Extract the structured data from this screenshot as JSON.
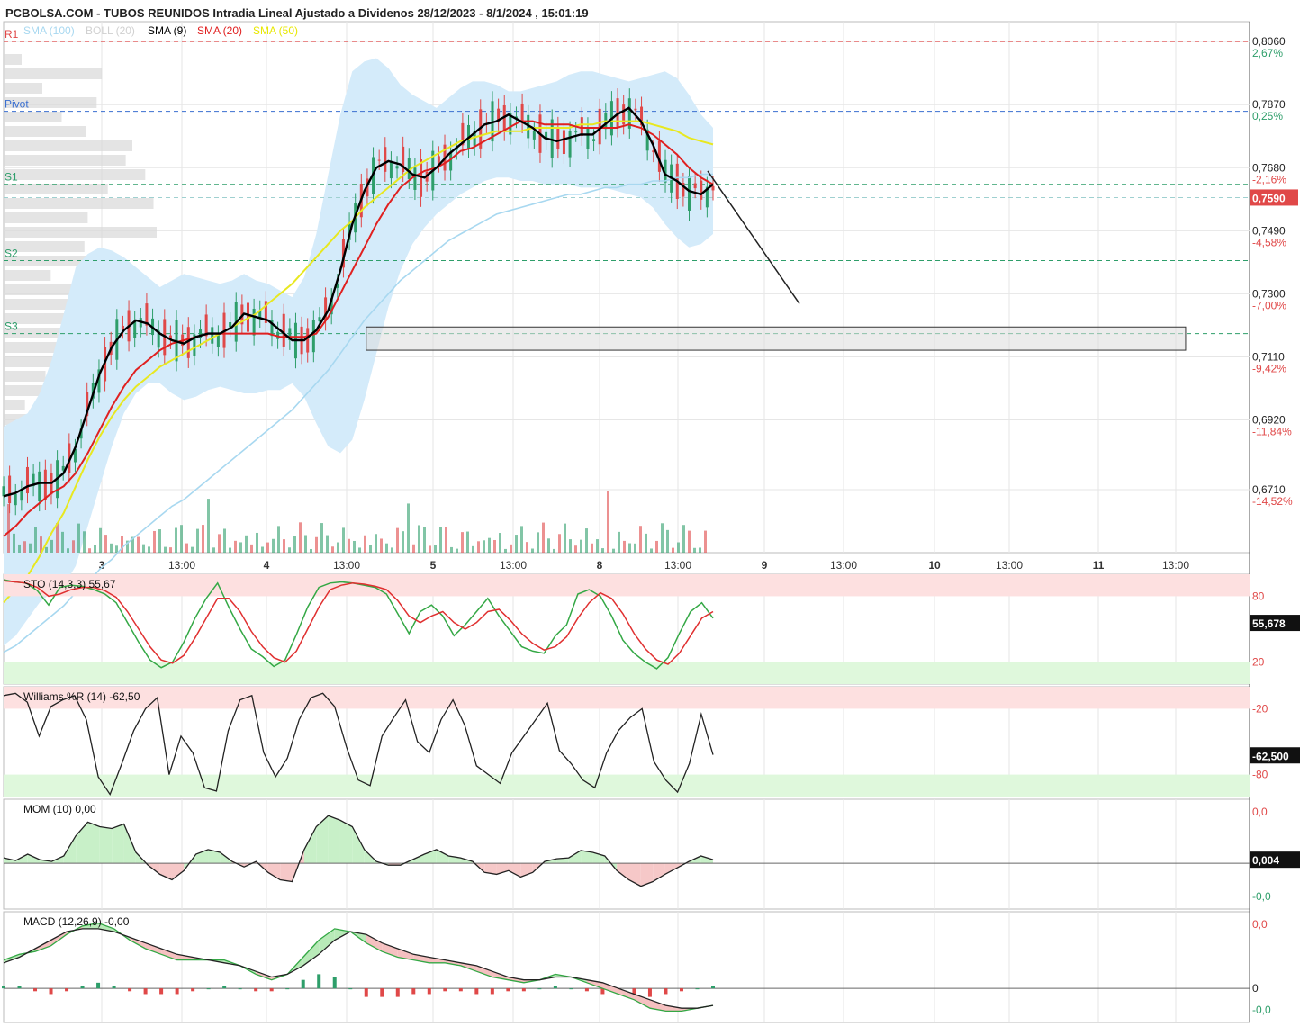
{
  "title": "PCBOLSA.COM - TUBOS REUNIDOS Intradia Lineal Ajustado a Dividenos 28/12/2023 - 8/1/2024 , 15:01:19",
  "legend": [
    {
      "label": "SMA",
      "value": "(100)",
      "color": "#a8d8f0"
    },
    {
      "label": "BOLL",
      "value": "(20)",
      "color": "#d0d0d0"
    },
    {
      "label": "SMA",
      "value": "(9)",
      "color": "#000000"
    },
    {
      "label": "SMA",
      "value": "(20)",
      "color": "#e02020"
    },
    {
      "label": "SMA",
      "value": "(50)",
      "color": "#e8e800"
    }
  ],
  "colors": {
    "up": "#2e9e6a",
    "down": "#e04848",
    "band": "#d4ebfa",
    "sma100": "#a8d8f0",
    "sma50": "#e8e820",
    "sma20": "#e02020",
    "sma9": "#000000",
    "grid": "#e6e6e6"
  },
  "chart_data": [
    {
      "type": "line",
      "name": "price",
      "ylim": [
        0.652,
        0.812
      ],
      "price_ticks": [
        {
          "value": 0.806,
          "label": "0,8060",
          "pct": "2,67%",
          "pct_color": "#2e9e6a"
        },
        {
          "value": 0.787,
          "label": "0,7870",
          "pct": "0,25%",
          "pct_color": "#2e9e6a"
        },
        {
          "value": 0.768,
          "label": "0,7680",
          "pct": "-2,16%",
          "pct_color": "#e04848"
        },
        {
          "value": 0.749,
          "label": "0,7490",
          "pct": "-4,58%",
          "pct_color": "#e04848"
        },
        {
          "value": 0.73,
          "label": "0,7300",
          "pct": "-7,00%",
          "pct_color": "#e04848"
        },
        {
          "value": 0.711,
          "label": "0,7110",
          "pct": "-9,42%",
          "pct_color": "#e04848"
        },
        {
          "value": 0.692,
          "label": "0,6920",
          "pct": "-11,84%",
          "pct_color": "#e04848"
        },
        {
          "value": 0.671,
          "label": "0,6710",
          "pct": "-14,52%",
          "pct_color": "#e04848"
        }
      ],
      "current_price": {
        "value": 0.759,
        "label": "0,7590"
      },
      "pivots": [
        {
          "label": "R1",
          "value": 0.806,
          "color": "#e04848"
        },
        {
          "label": "Pivot",
          "value": 0.785,
          "color": "#3a6fd0"
        },
        {
          "label": "S1",
          "value": 0.763,
          "color": "#2e9e6a"
        },
        {
          "label": "S2",
          "value": 0.74,
          "color": "#2e9e6a"
        },
        {
          "label": "S3",
          "value": 0.718,
          "color": "#2e9e6a"
        }
      ],
      "x_labels": [
        "3",
        "13:00",
        "4",
        "13:00",
        "5",
        "13:00",
        "8",
        "13:00",
        "9",
        "13:00",
        "10",
        "13:00",
        "11",
        "13:00"
      ],
      "sma9": [
        0.669,
        0.67,
        0.672,
        0.673,
        0.673,
        0.676,
        0.684,
        0.695,
        0.706,
        0.714,
        0.719,
        0.722,
        0.721,
        0.718,
        0.716,
        0.715,
        0.717,
        0.718,
        0.718,
        0.72,
        0.724,
        0.723,
        0.722,
        0.719,
        0.716,
        0.716,
        0.719,
        0.725,
        0.737,
        0.751,
        0.761,
        0.768,
        0.77,
        0.769,
        0.766,
        0.765,
        0.768,
        0.772,
        0.775,
        0.778,
        0.781,
        0.782,
        0.784,
        0.782,
        0.78,
        0.777,
        0.776,
        0.777,
        0.778,
        0.778,
        0.781,
        0.784,
        0.786,
        0.782,
        0.775,
        0.766,
        0.764,
        0.761,
        0.76,
        0.763
      ],
      "sma20": [
        0.657,
        0.66,
        0.664,
        0.667,
        0.67,
        0.672,
        0.676,
        0.682,
        0.689,
        0.696,
        0.702,
        0.707,
        0.71,
        0.713,
        0.715,
        0.716,
        0.717,
        0.718,
        0.718,
        0.718,
        0.718,
        0.718,
        0.718,
        0.717,
        0.717,
        0.717,
        0.718,
        0.723,
        0.73,
        0.737,
        0.744,
        0.751,
        0.757,
        0.762,
        0.765,
        0.767,
        0.768,
        0.77,
        0.773,
        0.774,
        0.776,
        0.778,
        0.78,
        0.782,
        0.782,
        0.781,
        0.781,
        0.781,
        0.78,
        0.78,
        0.78,
        0.78,
        0.781,
        0.78,
        0.778,
        0.775,
        0.772,
        0.768,
        0.765,
        0.763
      ],
      "sma50": [
        0.637,
        0.641,
        0.645,
        0.651,
        0.658,
        0.664,
        0.672,
        0.68,
        0.687,
        0.693,
        0.698,
        0.702,
        0.705,
        0.708,
        0.71,
        0.712,
        0.714,
        0.716,
        0.718,
        0.72,
        0.722,
        0.724,
        0.727,
        0.73,
        0.733,
        0.737,
        0.741,
        0.745,
        0.749,
        0.752,
        0.756,
        0.759,
        0.762,
        0.765,
        0.768,
        0.77,
        0.772,
        0.774,
        0.776,
        0.777,
        0.778,
        0.779,
        0.779,
        0.779,
        0.78,
        0.78,
        0.78,
        0.78,
        0.781,
        0.781,
        0.782,
        0.782,
        0.782,
        0.782,
        0.781,
        0.78,
        0.779,
        0.777,
        0.776,
        0.775
      ],
      "sma100": [
        0.622,
        0.624,
        0.627,
        0.63,
        0.633,
        0.636,
        0.64,
        0.643,
        0.647,
        0.65,
        0.654,
        0.657,
        0.66,
        0.663,
        0.666,
        0.668,
        0.671,
        0.674,
        0.677,
        0.68,
        0.683,
        0.686,
        0.689,
        0.692,
        0.695,
        0.699,
        0.703,
        0.707,
        0.712,
        0.717,
        0.722,
        0.726,
        0.73,
        0.734,
        0.737,
        0.74,
        0.743,
        0.746,
        0.748,
        0.75,
        0.752,
        0.754,
        0.755,
        0.756,
        0.757,
        0.758,
        0.759,
        0.76,
        0.76,
        0.761,
        0.762,
        0.762,
        0.763,
        0.763,
        0.764,
        0.764,
        0.765,
        0.765,
        0.766,
        0.766
      ],
      "boll_upper": [
        0.69,
        0.692,
        0.694,
        0.7,
        0.71,
        0.724,
        0.738,
        0.742,
        0.744,
        0.743,
        0.741,
        0.738,
        0.735,
        0.732,
        0.734,
        0.736,
        0.735,
        0.734,
        0.733,
        0.734,
        0.736,
        0.734,
        0.733,
        0.731,
        0.729,
        0.735,
        0.748,
        0.766,
        0.784,
        0.797,
        0.8,
        0.801,
        0.798,
        0.793,
        0.79,
        0.788,
        0.786,
        0.789,
        0.792,
        0.794,
        0.794,
        0.793,
        0.791,
        0.791,
        0.792,
        0.793,
        0.794,
        0.796,
        0.797,
        0.797,
        0.796,
        0.795,
        0.794,
        0.795,
        0.796,
        0.797,
        0.795,
        0.79,
        0.784,
        0.78
      ],
      "boll_lower": [
        0.624,
        0.627,
        0.632,
        0.637,
        0.64,
        0.642,
        0.648,
        0.66,
        0.672,
        0.684,
        0.694,
        0.7,
        0.703,
        0.703,
        0.7,
        0.698,
        0.699,
        0.701,
        0.702,
        0.701,
        0.7,
        0.7,
        0.701,
        0.701,
        0.703,
        0.699,
        0.691,
        0.684,
        0.682,
        0.686,
        0.698,
        0.712,
        0.726,
        0.737,
        0.745,
        0.75,
        0.754,
        0.757,
        0.76,
        0.762,
        0.764,
        0.765,
        0.765,
        0.764,
        0.764,
        0.763,
        0.763,
        0.763,
        0.762,
        0.762,
        0.762,
        0.761,
        0.76,
        0.759,
        0.756,
        0.751,
        0.747,
        0.744,
        0.745,
        0.748
      ],
      "projection": {
        "from": [
          0.786,
          0.767
        ],
        "to": [
          0.888,
          0.727
        ]
      },
      "support_zone": {
        "x": [
          0.291,
          0.917
        ],
        "y": [
          0.713,
          0.72
        ]
      }
    },
    {
      "type": "line",
      "name": "STO (14,3,3)",
      "header_value": "55,67",
      "current_label": "55,678",
      "ylim": [
        0,
        100
      ],
      "levels": [
        80,
        20
      ],
      "tick_labels": [
        "80",
        "20"
      ],
      "k": [
        95,
        93,
        92,
        85,
        72,
        88,
        90,
        89,
        86,
        82,
        74,
        56,
        38,
        22,
        15,
        20,
        38,
        60,
        78,
        92,
        70,
        50,
        32,
        25,
        16,
        22,
        45,
        70,
        88,
        92,
        93,
        92,
        90,
        88,
        82,
        64,
        46,
        66,
        72,
        62,
        44,
        54,
        66,
        78,
        62,
        48,
        34,
        30,
        28,
        44,
        54,
        82,
        86,
        80,
        62,
        40,
        28,
        20,
        14,
        24,
        46,
        66,
        74,
        60
      ],
      "d": [
        94,
        93,
        92,
        88,
        80,
        82,
        86,
        88,
        88,
        85,
        79,
        66,
        50,
        34,
        22,
        19,
        26,
        42,
        60,
        78,
        78,
        66,
        48,
        34,
        24,
        20,
        30,
        50,
        70,
        86,
        90,
        92,
        91,
        89,
        86,
        76,
        62,
        56,
        62,
        66,
        56,
        50,
        56,
        66,
        68,
        58,
        46,
        37,
        31,
        34,
        43,
        60,
        74,
        83,
        78,
        64,
        46,
        32,
        22,
        18,
        28,
        44,
        60,
        66
      ]
    },
    {
      "type": "line",
      "name": "Williams %R (14)",
      "header_value": "-62,50",
      "current_label": "-62,500",
      "ylim": [
        -100,
        0
      ],
      "levels": [
        -20,
        -80
      ],
      "tick_labels": [
        "-20",
        "-80"
      ],
      "values": [
        -8,
        -6,
        -14,
        -45,
        -18,
        -12,
        -8,
        -30,
        -82,
        -98,
        -70,
        -40,
        -20,
        -10,
        -80,
        -45,
        -60,
        -92,
        -95,
        -40,
        -12,
        -8,
        -60,
        -82,
        -65,
        -30,
        -10,
        -6,
        -18,
        -55,
        -85,
        -90,
        -45,
        -28,
        -12,
        -50,
        -60,
        -30,
        -12,
        -35,
        -72,
        -80,
        -88,
        -60,
        -45,
        -30,
        -15,
        -58,
        -70,
        -85,
        -92,
        -60,
        -40,
        -28,
        -20,
        -68,
        -85,
        -96,
        -70,
        -25,
        -62
      ]
    },
    {
      "type": "area",
      "name": "MOM (10)",
      "header_value": "0,00",
      "current_label": "0,004",
      "top_label": "0,0",
      "bottom_label": "-0,0",
      "ylim": [
        -0.05,
        0.07
      ],
      "values": [
        0.006,
        0.003,
        0.01,
        0.004,
        0.002,
        0.008,
        0.03,
        0.045,
        0.04,
        0.038,
        0.043,
        0.012,
        -0.002,
        -0.012,
        -0.018,
        -0.008,
        0.01,
        0.015,
        0.012,
        0.002,
        -0.004,
        0.002,
        -0.01,
        -0.018,
        -0.02,
        0.015,
        0.04,
        0.052,
        0.047,
        0.04,
        0.015,
        0.002,
        -0.002,
        -0.002,
        0.004,
        0.01,
        0.015,
        0.008,
        0.006,
        0.002,
        -0.01,
        -0.012,
        -0.008,
        -0.015,
        -0.01,
        0.002,
        0.005,
        0.006,
        0.014,
        0.012,
        0.008,
        -0.008,
        -0.018,
        -0.025,
        -0.02,
        -0.012,
        -0.005,
        0.002,
        0.008,
        0.004
      ]
    },
    {
      "type": "bar",
      "name": "MACD (12,26,9)",
      "header_value": "-0,00",
      "top_label": "0,0",
      "zero_label": "0",
      "bottom_label": "-0,0",
      "ylim": [
        -0.012,
        0.027
      ],
      "macd": [
        0.01,
        0.012,
        0.013,
        0.015,
        0.019,
        0.022,
        0.023,
        0.021,
        0.017,
        0.014,
        0.012,
        0.01,
        0.01,
        0.01,
        0.01,
        0.008,
        0.005,
        0.003,
        0.005,
        0.011,
        0.017,
        0.021,
        0.02,
        0.016,
        0.013,
        0.011,
        0.01,
        0.009,
        0.009,
        0.008,
        0.006,
        0.004,
        0.003,
        0.002,
        0.003,
        0.005,
        0.004,
        0.002,
        0.0,
        -0.002,
        -0.004,
        -0.007,
        -0.008,
        -0.008,
        -0.007,
        -0.006
      ],
      "signal": [
        0.009,
        0.011,
        0.014,
        0.017,
        0.02,
        0.021,
        0.021,
        0.02,
        0.018,
        0.016,
        0.014,
        0.012,
        0.011,
        0.01,
        0.009,
        0.008,
        0.006,
        0.004,
        0.005,
        0.008,
        0.012,
        0.017,
        0.02,
        0.019,
        0.016,
        0.014,
        0.012,
        0.011,
        0.01,
        0.009,
        0.008,
        0.006,
        0.004,
        0.003,
        0.003,
        0.004,
        0.004,
        0.003,
        0.002,
        0.0,
        -0.002,
        -0.004,
        -0.006,
        -0.007,
        -0.007,
        -0.006
      ],
      "histogram": [
        0.001,
        0.001,
        -0.001,
        -0.002,
        -0.001,
        0.001,
        0.002,
        0.001,
        -0.001,
        -0.002,
        -0.002,
        -0.002,
        -0.001,
        0.0,
        0.001,
        0.0,
        -0.001,
        -0.001,
        0.0,
        0.003,
        0.005,
        0.004,
        0.0,
        -0.003,
        -0.003,
        -0.003,
        -0.002,
        -0.002,
        -0.001,
        -0.001,
        -0.002,
        -0.002,
        -0.001,
        -0.001,
        0.0,
        0.001,
        0.0,
        -0.001,
        -0.002,
        -0.002,
        -0.002,
        -0.003,
        -0.002,
        -0.001,
        0.0,
        0.001
      ]
    }
  ]
}
